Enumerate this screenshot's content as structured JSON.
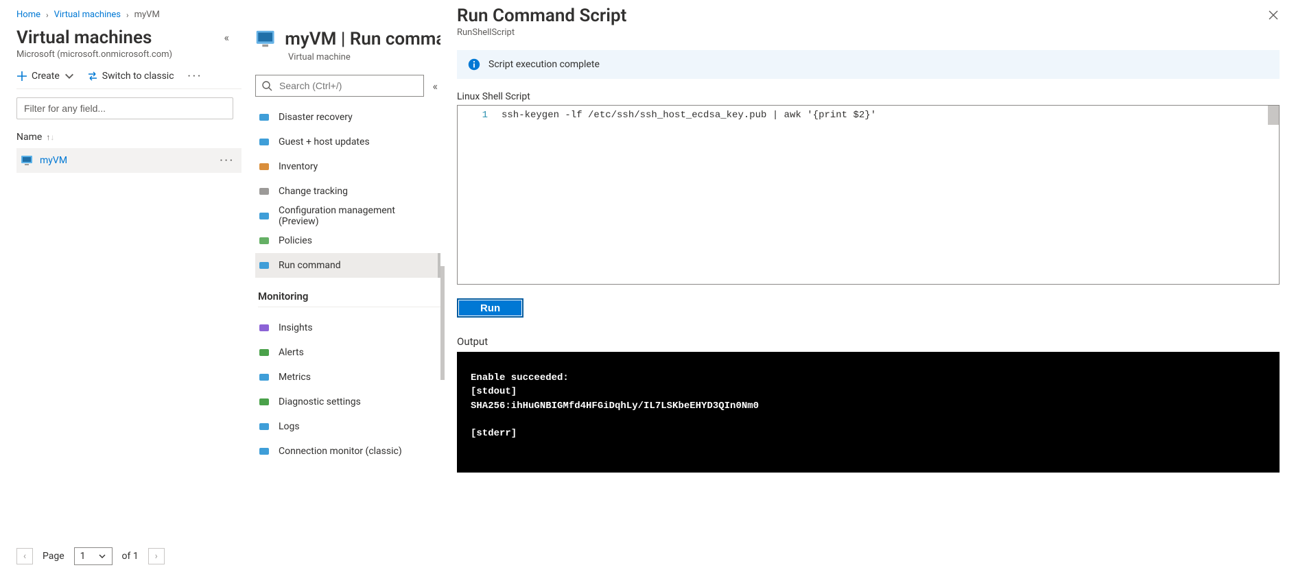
{
  "breadcrumb": {
    "home": "Home",
    "vms": "Virtual machines",
    "current": "myVM"
  },
  "left": {
    "title": "Virtual machines",
    "tenant": "Microsoft (microsoft.onmicrosoft.com)",
    "create": "Create",
    "switch": "Switch to classic",
    "filter_placeholder": "Filter for any field...",
    "col_name": "Name",
    "vm_name": "myVM",
    "page_label": "Page",
    "page_current": "1",
    "page_total": "of 1"
  },
  "mid": {
    "title": "myVM | Run command",
    "subtitle": "Virtual machine",
    "search_placeholder": "Search (Ctrl+/)",
    "items": [
      {
        "label": "Disaster recovery",
        "color": "#3f9ed8",
        "active": false
      },
      {
        "label": "Guest + host updates",
        "color": "#3f9ed8",
        "active": false
      },
      {
        "label": "Inventory",
        "color": "#d98e3b",
        "active": false
      },
      {
        "label": "Change tracking",
        "color": "#9c9a98",
        "active": false
      },
      {
        "label": "Configuration management (Preview)",
        "color": "#3f9ed8",
        "active": false
      },
      {
        "label": "Policies",
        "color": "#65b065",
        "active": false
      },
      {
        "label": "Run command",
        "color": "#3f9ed8",
        "active": true
      }
    ],
    "section_monitoring": "Monitoring",
    "monitoring_items": [
      {
        "label": "Insights",
        "color": "#8c63d6"
      },
      {
        "label": "Alerts",
        "color": "#4aa14a"
      },
      {
        "label": "Metrics",
        "color": "#3f9ed8"
      },
      {
        "label": "Diagnostic settings",
        "color": "#4aa14a"
      },
      {
        "label": "Logs",
        "color": "#3f9ed8"
      },
      {
        "label": "Connection monitor (classic)",
        "color": "#3f9ed8"
      }
    ]
  },
  "right": {
    "title": "Run Command Script",
    "subtitle": "RunShellScript",
    "info": "Script execution complete",
    "script_label": "Linux Shell Script",
    "line_number": "1",
    "script": "ssh-keygen -lf /etc/ssh/ssh_host_ecdsa_key.pub | awk '{print $2}'",
    "run": "Run",
    "output_label": "Output",
    "output": "Enable succeeded: \n[stdout]\nSHA256:ihHuGNBIGMfd4HFGiDqhLy/IL7LSKbeEHYD3QIn0Nm0\n\n[stderr]"
  }
}
